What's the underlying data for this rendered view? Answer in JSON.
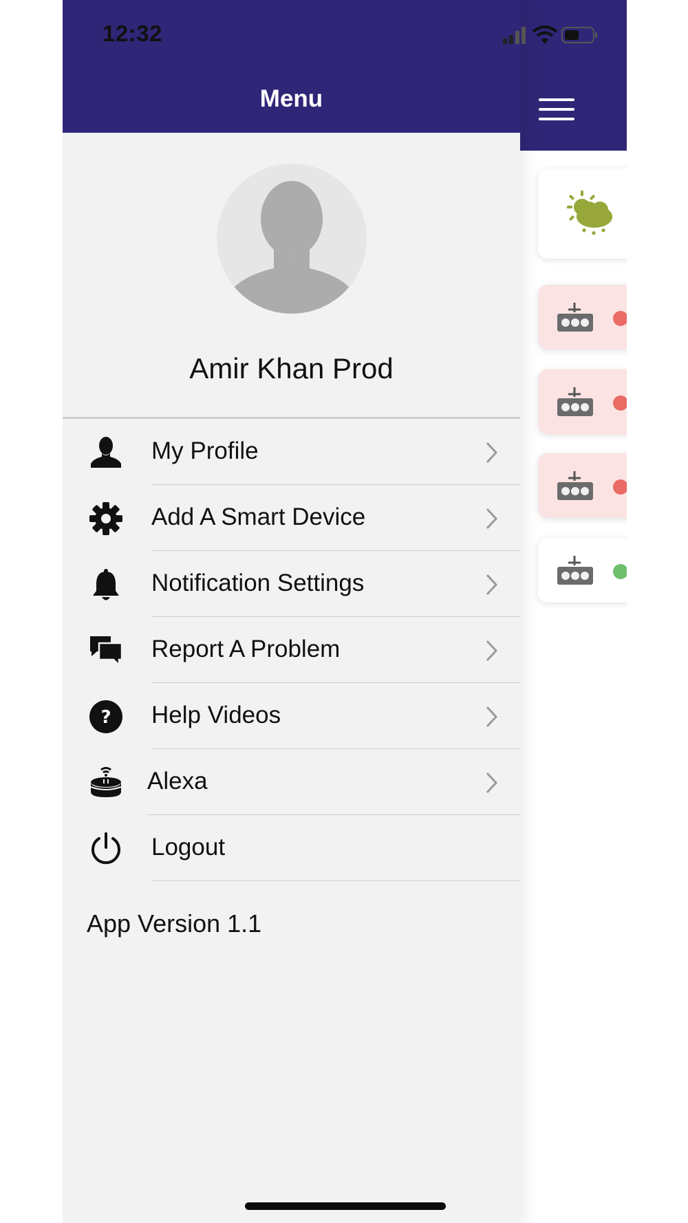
{
  "status_bar": {
    "time": "12:32"
  },
  "menu_panel": {
    "title": "Menu",
    "profile_name": "Amir Khan Prod",
    "items": [
      {
        "label": "My Profile",
        "icon": "person-icon"
      },
      {
        "label": "Add A Smart Device",
        "icon": "gear-icon"
      },
      {
        "label": "Notification Settings",
        "icon": "bell-icon"
      },
      {
        "label": "Report A Problem",
        "icon": "chat-bubbles-icon"
      },
      {
        "label": "Help Videos",
        "icon": "question-circle-icon"
      },
      {
        "label": "Alexa",
        "icon": "alexa-device-icon"
      },
      {
        "label": "Logout",
        "icon": "power-icon"
      }
    ],
    "app_version": "App Version 1.1"
  },
  "background_screen": {
    "cards": [
      {
        "type": "weather",
        "icon": "weather-cloud-rain-sun-icon"
      },
      {
        "type": "device",
        "icon": "power-strip-icon",
        "status_color": "#ea6a64",
        "card_color": "#fbe3e3"
      },
      {
        "type": "device",
        "icon": "power-strip-icon",
        "status_color": "#ea6a64",
        "card_color": "#fbe3e3"
      },
      {
        "type": "device",
        "icon": "power-strip-icon",
        "status_color": "#ea6a64",
        "card_color": "#fbe3e3"
      },
      {
        "type": "device",
        "icon": "power-strip-icon",
        "status_color": "#6fbf6e",
        "card_color": "#ffffff"
      }
    ]
  },
  "colors": {
    "header": "#302677",
    "drawer_bg": "#f2f2f2",
    "divider": "#cdcdcd",
    "weather_icon": "#97a73a"
  }
}
